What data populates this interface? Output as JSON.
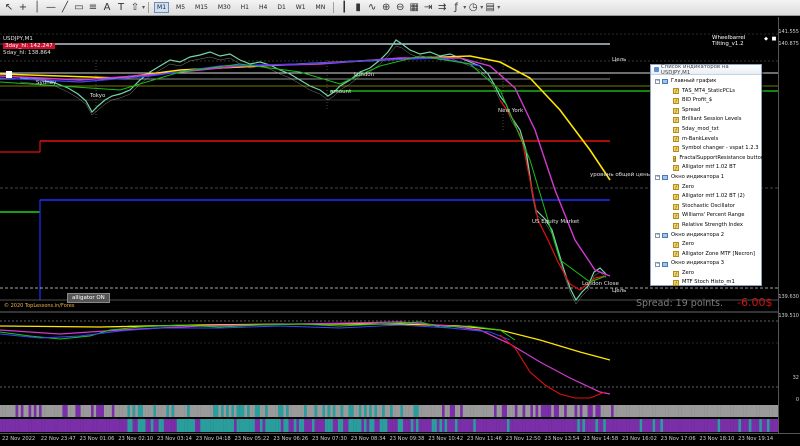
{
  "toolbar": {
    "timeframes": [
      "M1",
      "M5",
      "M15",
      "M30",
      "H1",
      "H4",
      "D1",
      "W1",
      "MN"
    ],
    "active_timeframe": "M1"
  },
  "chart": {
    "symbol_line": "USDJPY,M1",
    "info_line1": "3day_hl: 142.247",
    "info_line2": "5day_hl: 138.864",
    "title_right": "Wheelbarrel Tilting_v1.2",
    "sessions": {
      "sydney": "Sydney",
      "tokyo": "Tokyo",
      "london": "London",
      "amount": "amount",
      "new_york": "New York",
      "equity_market": "US Equity Market",
      "london_close": "London Close"
    },
    "level_labels": {
      "target1": "Цель",
      "avg_price": "уровень общей цены",
      "target2": "Цель"
    },
    "alligator_badge": "alligator ON",
    "copyright": "© 2020 TopLessons.in/Forex",
    "spread_text": "Spread:  19 points.",
    "spread_value": "-6.00$",
    "colors": {
      "red_level": "#e01010",
      "blue_level": "#1f2fff",
      "green_level": "#1fd11f",
      "yellow_line": "#ffe600",
      "magenta_line": "#d23ad2",
      "histo_purple": "#7a2ea8",
      "histo_teal": "#2a9d9d"
    }
  },
  "price_scale": {
    "labels": [
      "141.555",
      "140.875",
      "139.630",
      "139.510",
      "32",
      "0"
    ]
  },
  "time_axis": {
    "labels": [
      "22 Nov 2022",
      "22 Nov 23:47",
      "23 Nov 01:06",
      "23 Nov 02:10",
      "23 Nov 03:14",
      "23 Nov 04:18",
      "23 Nov 05:22",
      "23 Nov 06:26",
      "23 Nov 07:30",
      "23 Nov 08:34",
      "23 Nov 09:38",
      "23 Nov 10:42",
      "23 Nov 11:46",
      "23 Nov 12:50",
      "23 Nov 13:54",
      "23 Nov 14:58",
      "23 Nov 16:02",
      "23 Nov 17:06",
      "23 Nov 18:10",
      "23 Nov 19:14"
    ]
  },
  "indicator_panel": {
    "title": "Список индикаторов на USDJPY,M1",
    "groups": [
      {
        "label": "Главный график",
        "items": [
          "TAS_MT4_StaticPCLs",
          "BID Profit_$",
          "Spread",
          "Brilliant Session Levels",
          "5day_mod_txt",
          "m-BankLevels",
          "Symbol changer - vspat 1.2.3",
          "FractalSupportResistance button 1.05",
          "Alligator mtf 1.02 BT"
        ]
      },
      {
        "label": "Окно индикатора 1",
        "items": [
          "Zero",
          "Alligator mtf 1.02 BT (2)",
          "Stochastic Oscillator",
          "Williams' Percent Range",
          "Relative Strength Index"
        ]
      },
      {
        "label": "Окно индикатора 2",
        "items": [
          "Zero",
          "Alligator Zone MTF [Necron]"
        ]
      },
      {
        "label": "Окно индикатора 3",
        "items": [
          "Zero",
          "MTF Stoch Histo_m1"
        ]
      }
    ]
  }
}
